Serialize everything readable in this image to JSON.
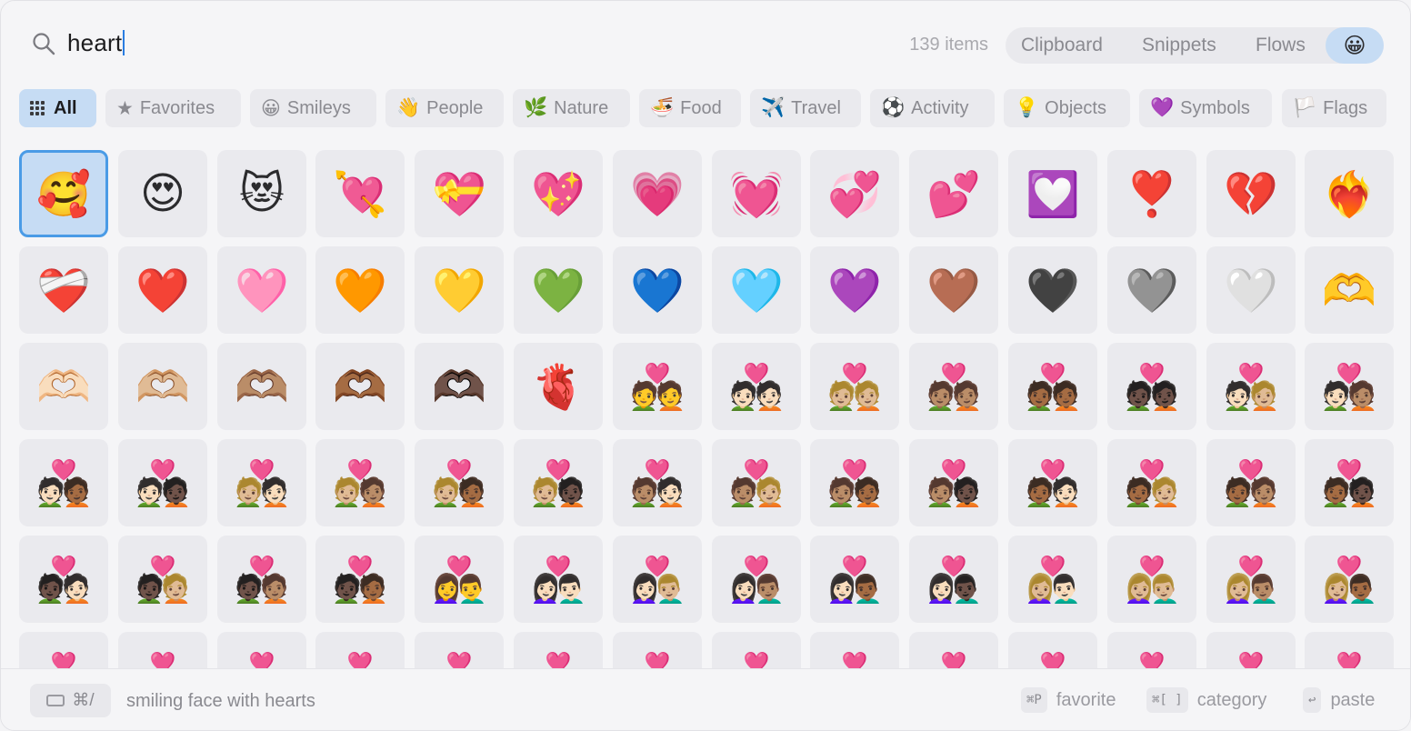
{
  "search": {
    "query": "heart"
  },
  "header": {
    "item_count": "139 items",
    "modes": [
      "Clipboard",
      "Snippets",
      "Flows"
    ],
    "active_mode_emoji": "😀"
  },
  "categories": [
    {
      "label": "All",
      "icon": "grid-icon",
      "active": true
    },
    {
      "label": "Favorites",
      "icon": "★"
    },
    {
      "label": "Smileys",
      "icon": "😀"
    },
    {
      "label": "People",
      "icon": "👋"
    },
    {
      "label": "Nature",
      "icon": "🌿"
    },
    {
      "label": "Food",
      "icon": "🍜"
    },
    {
      "label": "Travel",
      "icon": "✈️"
    },
    {
      "label": "Activity",
      "icon": "⚽"
    },
    {
      "label": "Objects",
      "icon": "💡"
    },
    {
      "label": "Symbols",
      "icon": "💜"
    },
    {
      "label": "Flags",
      "icon": "🏳️"
    }
  ],
  "emojis": [
    [
      "🥰",
      "😍",
      "😻",
      "💘",
      "💝",
      "💖",
      "💗",
      "💓",
      "💞",
      "💕",
      "💟",
      "❣️",
      "💔",
      "❤️‍🔥"
    ],
    [
      "❤️‍🩹",
      "❤️",
      "🩷",
      "🧡",
      "💛",
      "💚",
      "💙",
      "🩵",
      "💜",
      "🤎",
      "🖤",
      "🩶",
      "🤍",
      "🫶"
    ],
    [
      "🫶🏻",
      "🫶🏼",
      "🫶🏽",
      "🫶🏾",
      "🫶🏿",
      "🫀",
      "💑",
      "💑🏻",
      "💑🏼",
      "💑🏽",
      "💑🏾",
      "💑🏿",
      "🧑🏻‍❤️‍🧑🏼",
      "🧑🏻‍❤️‍🧑🏽"
    ],
    [
      "🧑🏻‍❤️‍🧑🏾",
      "🧑🏻‍❤️‍🧑🏿",
      "🧑🏼‍❤️‍🧑🏻",
      "🧑🏼‍❤️‍🧑🏽",
      "🧑🏼‍❤️‍🧑🏾",
      "🧑🏼‍❤️‍🧑🏿",
      "🧑🏽‍❤️‍🧑🏻",
      "🧑🏽‍❤️‍🧑🏼",
      "🧑🏽‍❤️‍🧑🏾",
      "🧑🏽‍❤️‍🧑🏿",
      "🧑🏾‍❤️‍🧑🏻",
      "🧑🏾‍❤️‍🧑🏼",
      "🧑🏾‍❤️‍🧑🏽",
      "🧑🏾‍❤️‍🧑🏿"
    ],
    [
      "🧑🏿‍❤️‍🧑🏻",
      "🧑🏿‍❤️‍🧑🏼",
      "🧑🏿‍❤️‍🧑🏽",
      "🧑🏿‍❤️‍🧑🏾",
      "👩‍❤️‍👨",
      "👩🏻‍❤️‍👨🏻",
      "👩🏻‍❤️‍👨🏼",
      "👩🏻‍❤️‍👨🏽",
      "👩🏻‍❤️‍👨🏾",
      "👩🏻‍❤️‍👨🏿",
      "👩🏼‍❤️‍👨🏻",
      "👩🏼‍❤️‍👨🏼",
      "👩🏼‍❤️‍👨🏽",
      "👩🏼‍❤️‍👨🏾"
    ],
    [
      "💑",
      "💑",
      "💑",
      "💑",
      "💑",
      "💑",
      "💑",
      "💑",
      "💑",
      "💑",
      "💑",
      "💑",
      "💑",
      "💑"
    ]
  ],
  "footer": {
    "shortcut": "⌘/",
    "selected_name": "smiling face with hearts",
    "hints": [
      {
        "key": "⌘P",
        "label": "favorite"
      },
      {
        "key": "⌘[ ]",
        "label": "category"
      },
      {
        "key": "↩",
        "label": "paste"
      }
    ]
  }
}
